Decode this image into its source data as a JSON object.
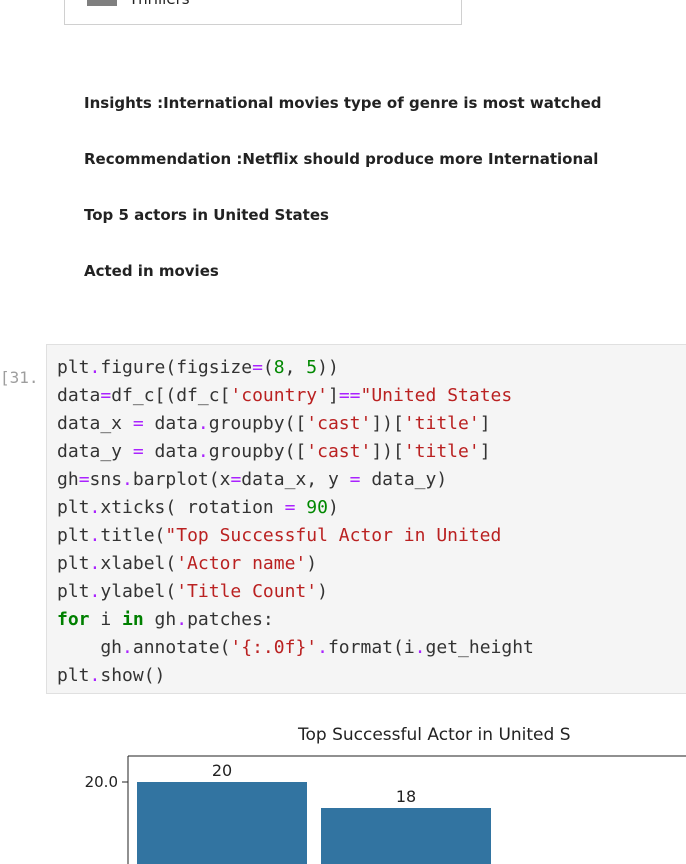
{
  "legend": {
    "label": "Thrillers"
  },
  "markdown": {
    "insights_label": "Insights :",
    "insights_text": "International movies type of genre is most watched",
    "recommendation_label": "Recommendation :",
    "recommendation_text": "Netflix should produce more International",
    "heading1": "Top 5 actors in United States",
    "heading2": "Acted in movies"
  },
  "cell": {
    "prompt": "[31...",
    "lines": [
      "plt.figure(figsize=(8, 5))",
      "data=df_c[(df_c['country']==\"United States",
      "data_x = data.groupby(['cast'])['title']",
      "data_y = data.groupby(['cast'])['title']",
      "gh=sns.barplot(x=data_x, y = data_y)",
      "plt.xticks( rotation = 90)",
      "plt.title(\"Top Successful Actor in United",
      "plt.xlabel('Actor name')",
      "plt.ylabel('Title Count')",
      "for i in gh.patches:",
      "    gh.annotate('{:.0f}'.format(i.get_height",
      "plt.show()"
    ]
  },
  "chart_data": {
    "type": "bar",
    "title": "Top Successful Actor in United S",
    "ytick_labels": [
      "20.0"
    ],
    "bars": [
      {
        "value": 20,
        "label": "20"
      },
      {
        "value": 18,
        "label": "18"
      }
    ],
    "bar_color": "#3274a1"
  }
}
